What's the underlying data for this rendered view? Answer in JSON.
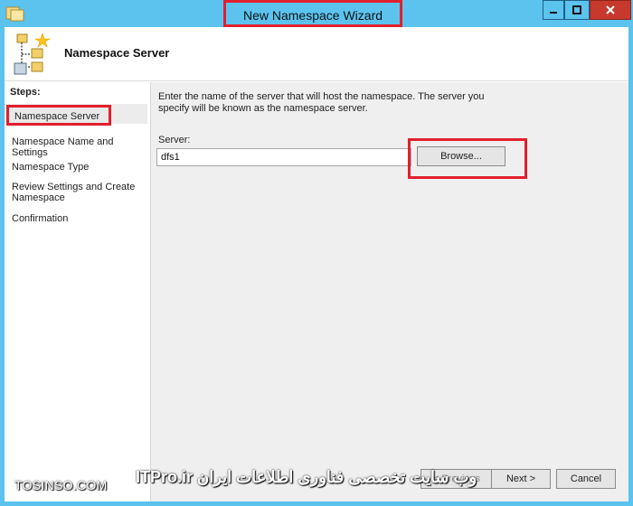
{
  "window": {
    "title": "New Namespace Wizard",
    "title_highlight_color": "#e21f2c",
    "titlebar_color": "#5bc3ee"
  },
  "header": {
    "title": "Namespace Server",
    "icon": "namespace-tree-icon"
  },
  "steps": {
    "label": "Steps:",
    "items": [
      {
        "label": "Namespace Server",
        "active": true
      },
      {
        "label": "Namespace Name and Settings",
        "active": false
      },
      {
        "label": "Namespace Type",
        "active": false
      },
      {
        "label": "Review Settings and Create Namespace",
        "active": false
      },
      {
        "label": "Confirmation",
        "active": false
      }
    ]
  },
  "content": {
    "description": "Enter the name of the server that will host the namespace. The server you specify will be known as the namespace server.",
    "server_label": "Server:",
    "server_value": "dfs1",
    "browse_label": "Browse..."
  },
  "footer": {
    "previous_label": "< Previous",
    "next_label": "Next >",
    "cancel_label": "Cancel"
  },
  "watermark": {
    "left": "TOSINSO.COM",
    "right": "وب سایت تخصصی فناوری اطلاعات ایران ITPro.ir"
  }
}
